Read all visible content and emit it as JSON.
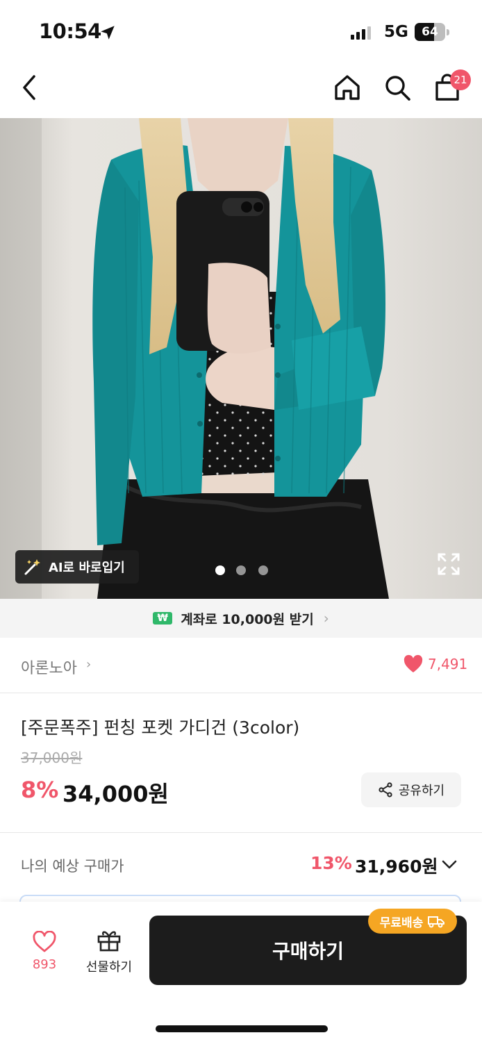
{
  "status": {
    "time": "10:54",
    "network": "5G",
    "battery": "64"
  },
  "nav": {
    "cart_count": "21"
  },
  "hero": {
    "ai_label": "AI로 바로입기",
    "carousel_total": 3,
    "carousel_active": 1
  },
  "bank": {
    "icon": "₩",
    "text": "계좌로 10,000원 받기"
  },
  "brand": {
    "name": "아론노아",
    "likes": "7,491"
  },
  "product": {
    "title": "[주문폭주] 펀칭 포켓 가디건 (3color)",
    "original_price": "37,000원",
    "discount": "8%",
    "price": "34,000원",
    "share_label": "공유하기"
  },
  "estimate": {
    "label": "나의 예상 구매가",
    "discount": "13%",
    "price": "31,960원"
  },
  "bottom": {
    "wish_count": "893",
    "gift_label": "선물하기",
    "buy_label": "구매하기",
    "free_shipping": "무료배송"
  },
  "colors": {
    "accent": "#f0566a",
    "buy_button": "#1c1c1c",
    "free_ship": "#f5a623",
    "cardigan": "#14949a"
  }
}
